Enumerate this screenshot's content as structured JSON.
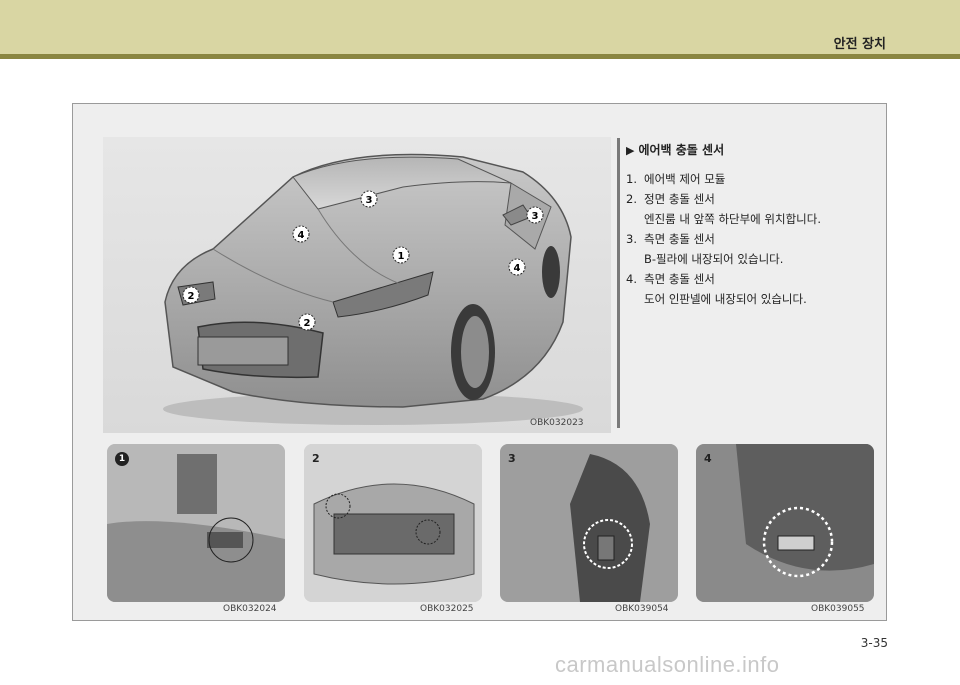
{
  "header": {
    "section_title": "안전 장치"
  },
  "main_image": {
    "code": "OBK032023",
    "callouts": [
      "1",
      "2",
      "2",
      "3",
      "3",
      "4",
      "4"
    ]
  },
  "legend": {
    "title": "에어백 충돌 센서",
    "items": [
      {
        "num": "1.",
        "text": "에어백 제어 모듈",
        "sub": ""
      },
      {
        "num": "2.",
        "text": "정면 충돌 센서",
        "sub": "엔진룸 내 앞쪽 하단부에 위치합니다."
      },
      {
        "num": "3.",
        "text": "측면 충돌 센서",
        "sub": "B-필라에 내장되어 있습니다."
      },
      {
        "num": "4.",
        "text": "측면 충돌 센서",
        "sub": "도어 인판넬에 내장되어 있습니다."
      }
    ]
  },
  "thumbnails": [
    {
      "label": "1",
      "code": "OBK032024"
    },
    {
      "label": "2",
      "code": "OBK032025"
    },
    {
      "label": "3",
      "code": "OBK039054"
    },
    {
      "label": "4",
      "code": "OBK039055"
    }
  ],
  "page_number": "3-35",
  "watermark": "carmanualsonline.info"
}
